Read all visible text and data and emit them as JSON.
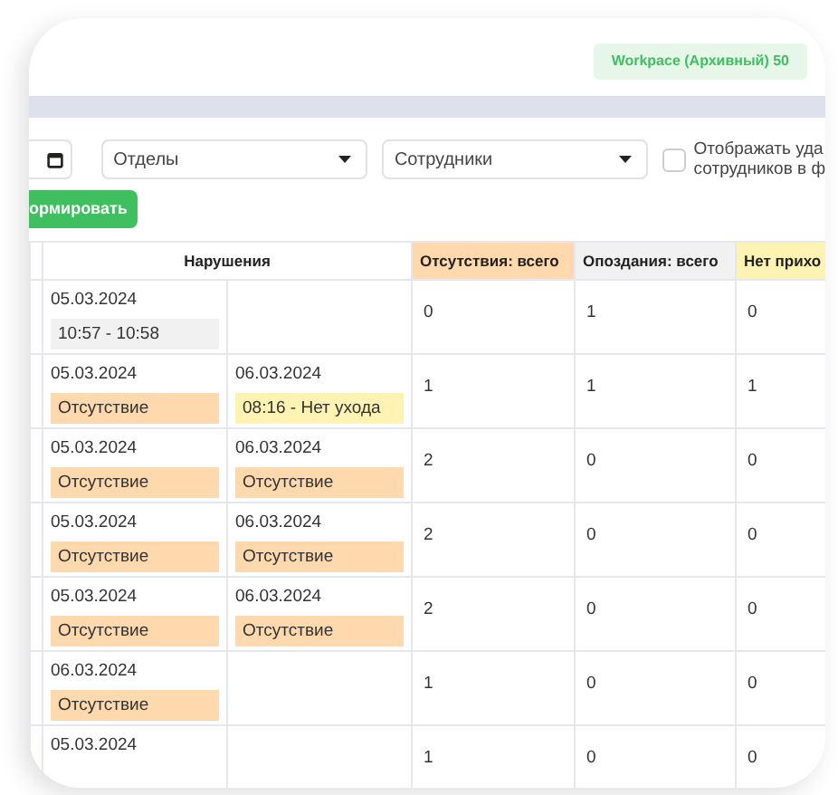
{
  "badge": "Workpace (Архивный) 50",
  "filters": {
    "departments": {
      "placeholder": "Отделы"
    },
    "employees": {
      "placeholder": "Сотрудники"
    },
    "show_deleted": {
      "checked": false,
      "label_lines": [
        "Отображать уда",
        "сотрудников в ф"
      ]
    }
  },
  "submit_button": "ормировать",
  "table": {
    "columns": [
      {
        "label": "Нарушения",
        "color": "#ffffff"
      },
      {
        "label": "Отсутствия: всего",
        "color": "#fed9ae"
      },
      {
        "label": "Опоздания: всего",
        "color": "#f1f1f1"
      },
      {
        "label": "Нет прихо",
        "color": "#fff3b3"
      }
    ],
    "rows": [
      {
        "first": {
          "date": "05.03.2024",
          "chip": {
            "kind": "time",
            "text": "10:57 - 10:58"
          }
        },
        "totals": [
          "0",
          "1",
          "0"
        ]
      },
      {
        "first": {
          "date": "05.03.2024",
          "chip": {
            "kind": "absence",
            "text": "Отсутствие"
          }
        },
        "second": {
          "date": "06.03.2024",
          "chip": {
            "kind": "no_leave",
            "text": "08:16 - Нет ухода"
          }
        },
        "totals": [
          "1",
          "1",
          "1"
        ]
      },
      {
        "first": {
          "date": "05.03.2024",
          "chip": {
            "kind": "absence",
            "text": "Отсутствие"
          }
        },
        "second": {
          "date": "06.03.2024",
          "chip": {
            "kind": "absence",
            "text": "Отсутствие"
          }
        },
        "totals": [
          "2",
          "0",
          "0"
        ]
      },
      {
        "first": {
          "date": "05.03.2024",
          "chip": {
            "kind": "absence",
            "text": "Отсутствие"
          }
        },
        "second": {
          "date": "06.03.2024",
          "chip": {
            "kind": "absence",
            "text": "Отсутствие"
          }
        },
        "totals": [
          "2",
          "0",
          "0"
        ]
      },
      {
        "first": {
          "date": "05.03.2024",
          "chip": {
            "kind": "absence",
            "text": "Отсутствие"
          }
        },
        "second": {
          "date": "06.03.2024",
          "chip": {
            "kind": "absence",
            "text": "Отсутствие"
          }
        },
        "totals": [
          "2",
          "0",
          "0"
        ]
      },
      {
        "first": {
          "date": "06.03.2024",
          "chip": {
            "kind": "absence",
            "text": "Отсутствие"
          }
        },
        "totals": [
          "1",
          "0",
          "0"
        ]
      },
      {
        "first": {
          "date": "05.03.2024"
        },
        "totals": [
          "1",
          "0",
          "0"
        ]
      }
    ]
  }
}
